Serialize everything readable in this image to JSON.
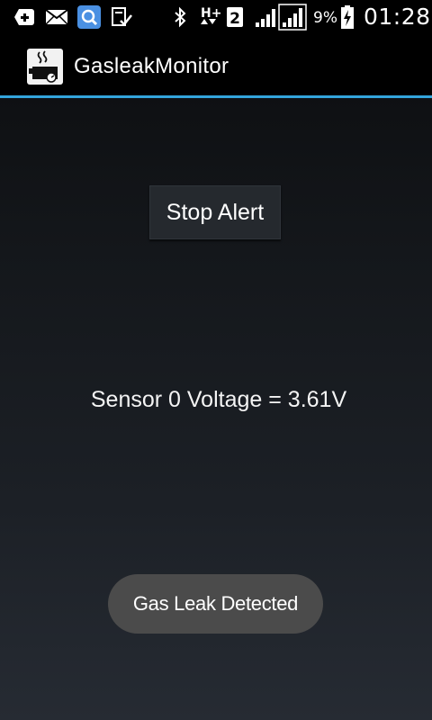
{
  "status_bar": {
    "icons_left": [
      "add-notification-icon",
      "mail-icon",
      "search-app-icon",
      "clipboard-check-icon"
    ],
    "icons_right": [
      "bluetooth-icon",
      "hplus-data-icon",
      "sim-2-icon",
      "signal-strength-icon",
      "signal-strength-icon",
      "battery-charging-icon"
    ],
    "network_type": "H+",
    "sim_slot": "2",
    "battery_percent": "9%",
    "time": "01:28"
  },
  "action_bar": {
    "title": "GasleakMonitor",
    "divider_color": "#33a5dc"
  },
  "main": {
    "stop_button_label": "Stop Alert",
    "sensor_reading": "Sensor 0 Voltage = 3.61V"
  },
  "toast": {
    "message": "Gas Leak Detected"
  }
}
